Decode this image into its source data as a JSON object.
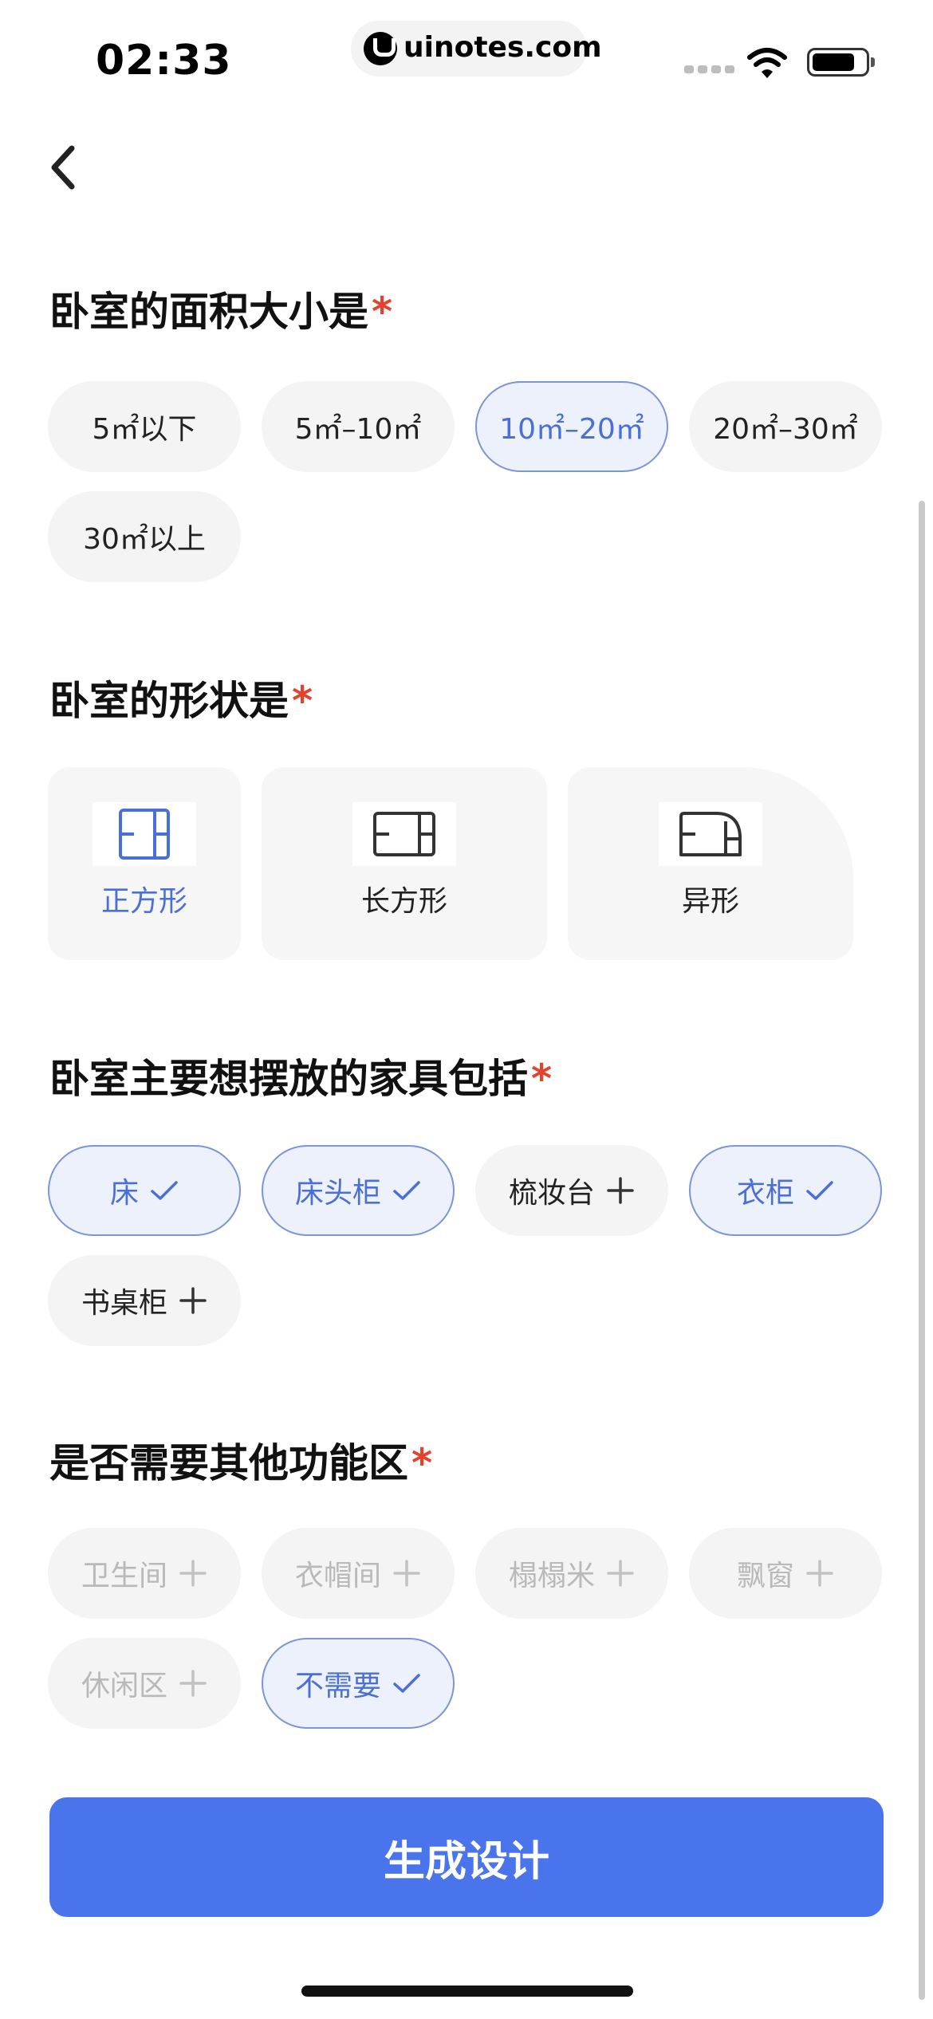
{
  "status_bar": {
    "time": "02:33",
    "site": "uinotes.com"
  },
  "icons": {
    "back": "back-chevron-icon",
    "check": "check-icon",
    "plus": "plus-icon",
    "wifi": "wifi-icon",
    "battery": "battery-icon"
  },
  "colors": {
    "accent": "#4a74ec",
    "selected_text": "#4a6fd6",
    "required": "#e8412b"
  },
  "area": {
    "title": "卧室的面积大小是",
    "required_mark": "*",
    "options": [
      {
        "label": "5㎡以下",
        "selected": false
      },
      {
        "label": "5㎡–10㎡",
        "selected": false
      },
      {
        "label": "10㎡–20㎡",
        "selected": true
      },
      {
        "label": "20㎡–30㎡",
        "selected": false
      },
      {
        "label": "30㎡以上",
        "selected": false
      }
    ]
  },
  "shape": {
    "title": "卧室的形状是",
    "required_mark": "*",
    "options": [
      {
        "label": "正方形",
        "icon": "square-room-icon",
        "selected": true
      },
      {
        "label": "长方形",
        "icon": "rectangle-room-icon",
        "selected": false
      },
      {
        "label": "异形",
        "icon": "irregular-room-icon",
        "selected": false
      }
    ]
  },
  "furniture": {
    "title": "卧室主要想摆放的家具包括",
    "required_mark": "*",
    "options": [
      {
        "label": "床",
        "selected": true
      },
      {
        "label": "床头柜",
        "selected": true
      },
      {
        "label": "梳妆台",
        "selected": false
      },
      {
        "label": "衣柜",
        "selected": true
      },
      {
        "label": "书桌柜",
        "selected": false
      }
    ]
  },
  "functional": {
    "title": "是否需要其他功能区",
    "required_mark": "*",
    "options": [
      {
        "label": "卫生间",
        "selected": false,
        "disabled": true
      },
      {
        "label": "衣帽间",
        "selected": false,
        "disabled": true
      },
      {
        "label": "榻榻米",
        "selected": false,
        "disabled": true
      },
      {
        "label": "飘窗",
        "selected": false,
        "disabled": true
      },
      {
        "label": "休闲区",
        "selected": false,
        "disabled": true
      },
      {
        "label": "不需要",
        "selected": true,
        "disabled": false
      }
    ]
  },
  "submit": {
    "label": "生成设计"
  }
}
